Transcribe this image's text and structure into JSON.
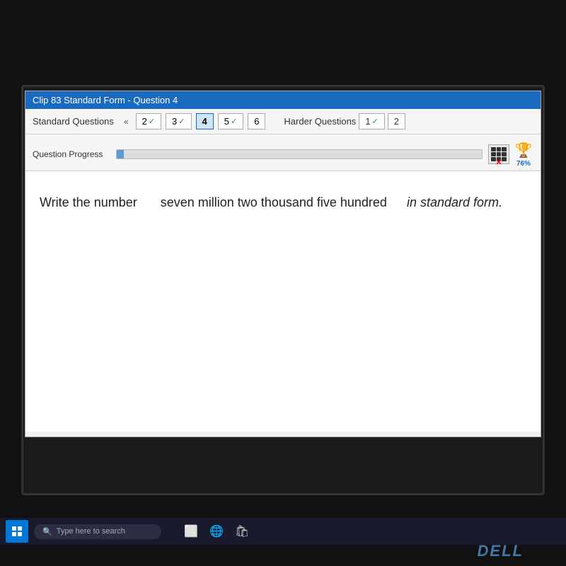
{
  "title_bar": {
    "label": "Clip 83 Standard Form - Question 4"
  },
  "toolbar": {
    "standard_questions_label": "Standard Questions",
    "nav_back": "«",
    "tabs": [
      {
        "id": 2,
        "label": "2",
        "check": "✓",
        "active": false
      },
      {
        "id": 3,
        "label": "3",
        "check": "✓",
        "active": false
      },
      {
        "id": 4,
        "label": "4",
        "check": "",
        "active": true
      },
      {
        "id": 5,
        "label": "5",
        "check": "✓",
        "active": false
      },
      {
        "id": 6,
        "label": "6",
        "check": "",
        "active": false
      }
    ],
    "harder_questions_label": "Harder Questions",
    "harder_tabs": [
      {
        "id": 1,
        "label": "1",
        "check": "✓",
        "active": false
      },
      {
        "id": 2,
        "label": "2",
        "check": "",
        "active": false
      }
    ]
  },
  "progress": {
    "label": "Question Progress",
    "value": 0,
    "percent_label": "76%"
  },
  "question": {
    "write_the_number": "Write the number",
    "number_phrase": "seven million two thousand five hundred",
    "in_standard_form": "in standard form."
  },
  "taskbar": {
    "search_placeholder": "Type here to search",
    "dell_label": "DELL"
  }
}
